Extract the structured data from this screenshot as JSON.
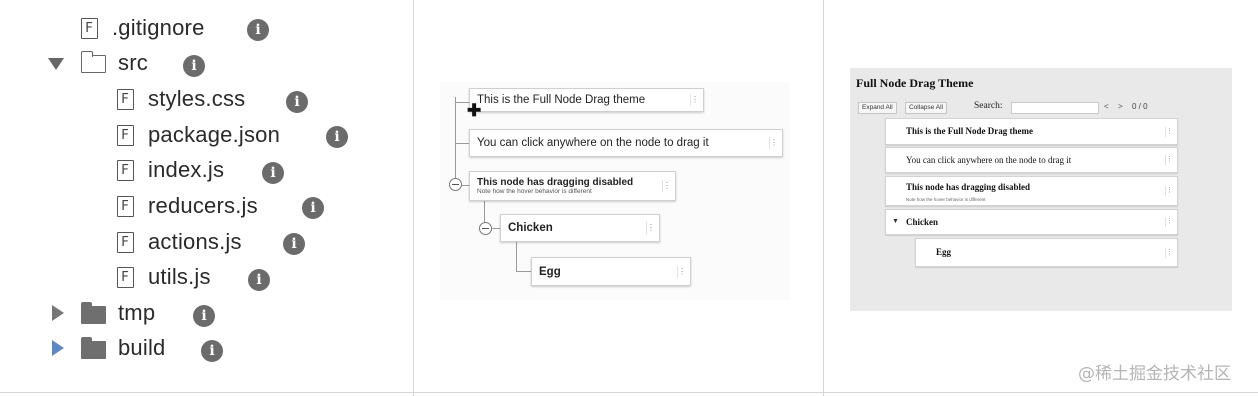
{
  "file_tree": {
    "items": [
      {
        "name": ".gitignore",
        "kind": "file"
      },
      {
        "name": "src",
        "kind": "folder-open",
        "toggle": "expanded"
      },
      {
        "name": "styles.css",
        "kind": "file"
      },
      {
        "name": "package.json",
        "kind": "file"
      },
      {
        "name": "index.js",
        "kind": "file"
      },
      {
        "name": "reducers.js",
        "kind": "file"
      },
      {
        "name": "actions.js",
        "kind": "file"
      },
      {
        "name": "utils.js",
        "kind": "file"
      },
      {
        "name": "tmp",
        "kind": "folder-closed",
        "toggle": "collapsed"
      },
      {
        "name": "build",
        "kind": "folder-closed",
        "toggle": "collapsed"
      }
    ],
    "info_glyph": "i",
    "file_glyph": "F",
    "icons": {
      "file": "file-icon",
      "folder": "folder-icon",
      "info": "info-icon",
      "expand": "caret-right-icon",
      "collapse": "caret-down-icon"
    }
  },
  "drag_theme": {
    "nodes": {
      "n1": {
        "label": "This is the Full Node Drag theme"
      },
      "n2": {
        "label": "You can click anywhere on the node to drag it"
      },
      "n3": {
        "label": "This node has dragging disabled",
        "subtitle": "Note how the hover behavior is different"
      },
      "n4": {
        "label": "Chicken"
      },
      "n5": {
        "label": "Egg"
      }
    },
    "menu_glyph": "⋮",
    "cursor_glyph": "✚"
  },
  "theme_screenshot": {
    "title": "Full Node Drag Theme",
    "expand_all": "Expand All",
    "collapse_all": "Collapse All",
    "search_label": "Search:",
    "prev": "<",
    "next": ">",
    "count": "0 / 0",
    "nodes": {
      "s1": {
        "label": "This is the Full Node Drag theme"
      },
      "s2": {
        "label": "You can click anywhere on the node to drag it"
      },
      "s3": {
        "label": "This node has dragging disabled",
        "subtitle": "Note how the hover behavior is different"
      },
      "s4": {
        "label": "Chicken",
        "toggle": "▼"
      },
      "s5": {
        "label": "Egg"
      }
    },
    "menu_glyph": "⋮"
  },
  "watermark": "@稀土掘金技术社区",
  "colors": {
    "info_badge": "#6b6b6b",
    "expand_caret_active": "#5e88c4",
    "border": "#d6d6d6",
    "panel_bg": "#e9e9e9"
  }
}
